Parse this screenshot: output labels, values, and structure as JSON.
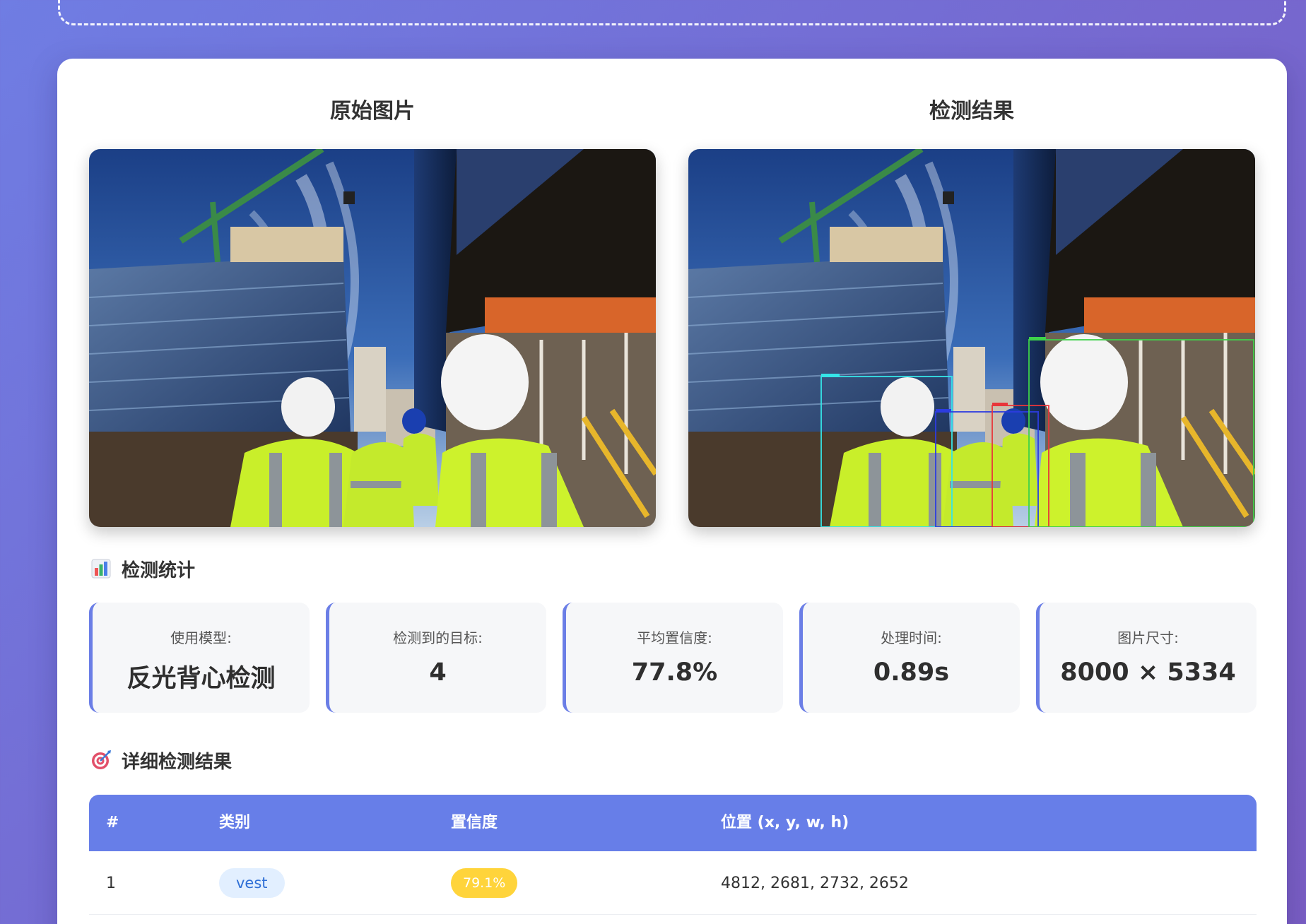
{
  "images": {
    "original_title": "原始图片",
    "result_title": "检测结果"
  },
  "stats_section": {
    "title": "检测统计",
    "icon": "bar-chart-icon",
    "items": [
      {
        "label": "使用模型:",
        "value": "反光背心检测"
      },
      {
        "label": "检测到的目标:",
        "value": "4"
      },
      {
        "label": "平均置信度:",
        "value": "77.8%"
      },
      {
        "label": "处理时间:",
        "value": "0.89s"
      },
      {
        "label": "图片尺寸:",
        "value": "8000 × 5334"
      }
    ]
  },
  "details_section": {
    "title": "详细检测结果",
    "icon": "target-icon",
    "columns": [
      "#",
      "类别",
      "置信度",
      "位置 (x, y, w, h)"
    ],
    "rows": [
      {
        "index": "1",
        "class": "vest",
        "confidence": "79.1%",
        "position": "4812, 2681, 2732, 2652"
      }
    ]
  },
  "colors": {
    "accent": "#677ee8",
    "confidence_badge": "#ffd43b",
    "class_badge_bg": "#e2efff"
  }
}
